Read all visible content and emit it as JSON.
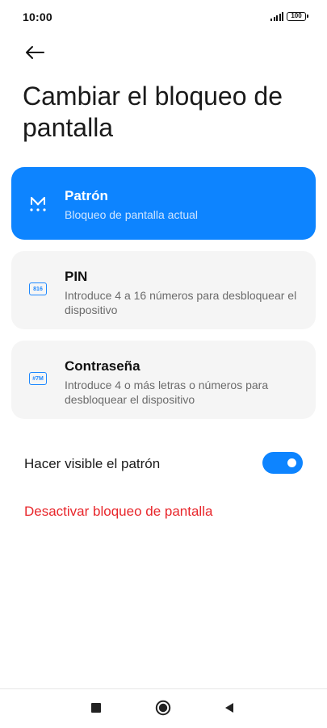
{
  "status_bar": {
    "time": "10:00",
    "battery": "100"
  },
  "header": {
    "back_icon": "arrow-left-icon",
    "title": "Cambiar el bloqueo de pantalla"
  },
  "options": [
    {
      "icon": "pattern-icon",
      "title": "Patrón",
      "description": "Bloqueo de pantalla actual",
      "selected": true
    },
    {
      "icon": "pin-icon",
      "icon_text": "816",
      "title": "PIN",
      "description": "Introduce 4 a 16 números para desbloquear el dispositivo",
      "selected": false
    },
    {
      "icon": "password-icon",
      "icon_text": "#7M",
      "title": "Contraseña",
      "description": "Introduce 4 o más letras o números para desbloquear el dispositivo",
      "selected": false
    }
  ],
  "settings": {
    "visible_pattern_label": "Hacer visible el patrón",
    "visible_pattern_on": true,
    "disable_lock_label": "Desactivar bloqueo de pantalla"
  },
  "colors": {
    "accent": "#0d84ff",
    "danger": "#e8262b",
    "card_bg": "#f5f5f5"
  },
  "nav_bar": {
    "recent_icon": "square-icon",
    "home_icon": "circle-icon",
    "back_icon": "triangle-back-icon"
  }
}
